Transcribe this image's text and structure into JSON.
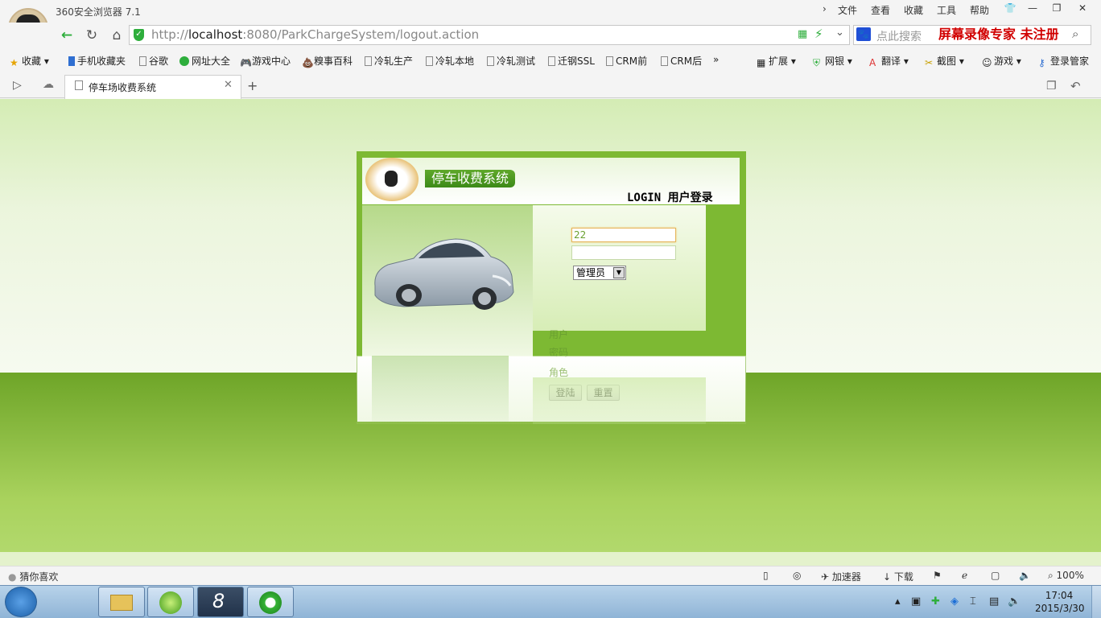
{
  "browser": {
    "app_title": "360安全浏览器 7.1",
    "menu": [
      "文件",
      "查看",
      "收藏",
      "工具",
      "帮助"
    ],
    "url_protocol": "http://",
    "url_host": "localhost",
    "url_rest": ":8080/ParkChargeSystem/logout.action",
    "search_placeholder": "点此搜索",
    "recorder_text": "屏幕录像专家  未注册",
    "bookmarks": [
      "收藏",
      "手机收藏夹",
      "谷歌",
      "网址大全",
      "游戏中心",
      "糗事百科",
      "冷轧生产",
      "冷轧本地",
      "冷轧测试",
      "迁钢SSL",
      "CRM前",
      "CRM后",
      "»"
    ],
    "extensions": [
      "扩展",
      "网银",
      "翻译",
      "截图",
      "游戏",
      "登录管家"
    ],
    "tab_label": "停车场收费系统",
    "status_left": "猜你喜欢",
    "status_right": [
      "加速器",
      "下载",
      "100%"
    ]
  },
  "login": {
    "system_name": "停车收费系统",
    "title": "LOGIN 用户登录",
    "user_label": "用户",
    "user_value": "22",
    "password_label": "密码",
    "role_label": "角色",
    "role_value": "管理员",
    "login_button": "登陆",
    "reset_button": "重置"
  },
  "taskbar": {
    "time": "17:04",
    "date": "2015/3/30"
  },
  "colors": {
    "brand_green": "#7db933",
    "recorder_red": "#d10000"
  }
}
